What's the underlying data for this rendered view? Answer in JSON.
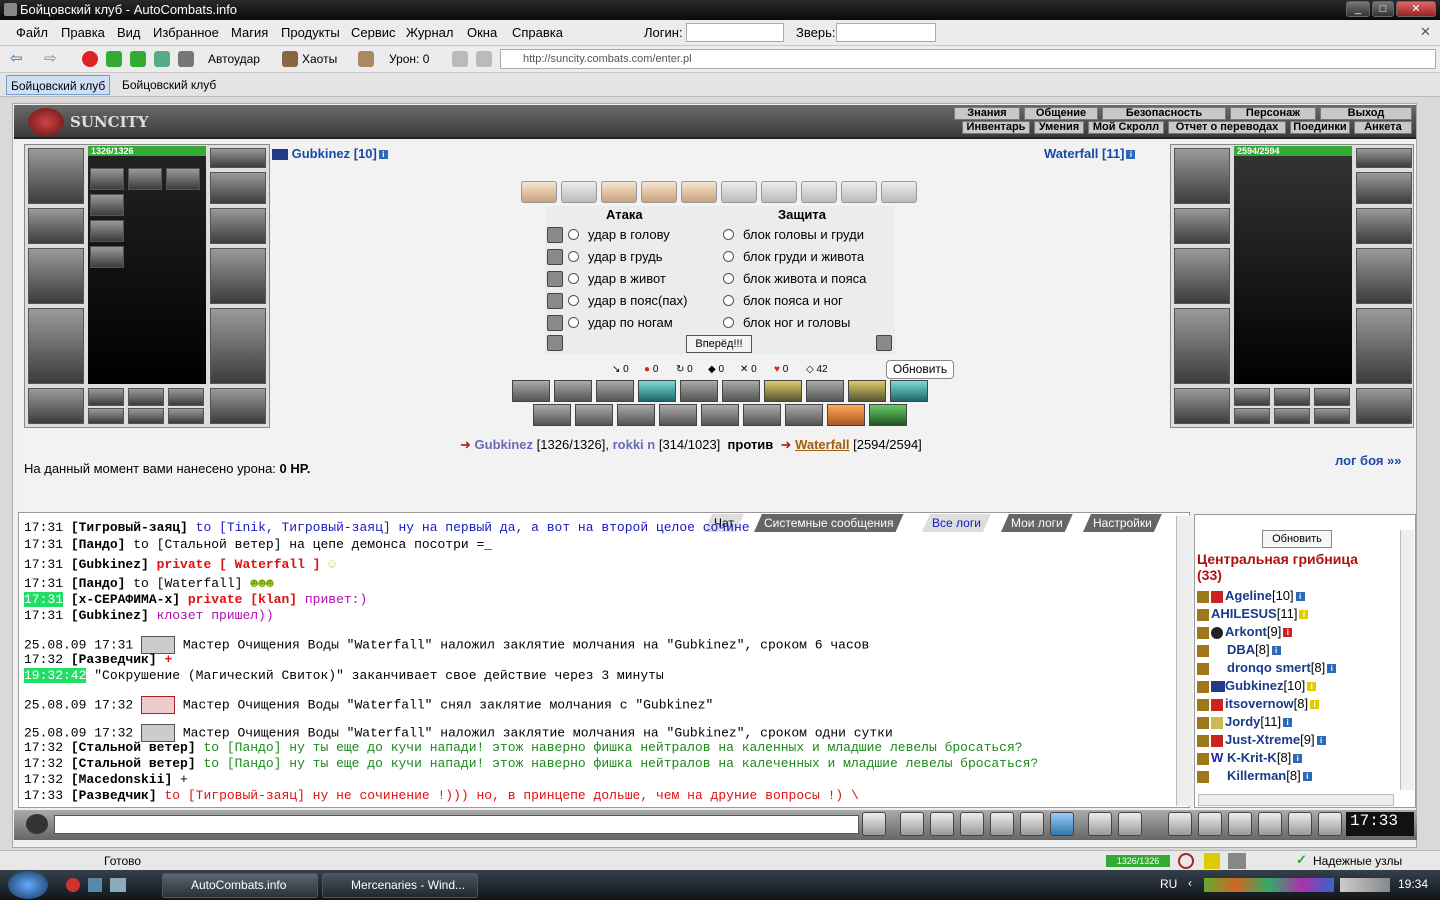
{
  "window": {
    "title": "Бойцовский клуб - AutoCombats.info"
  },
  "menu": {
    "items": [
      "Файл",
      "Правка",
      "Вид",
      "Избранное",
      "Магия",
      "Продукты",
      "Сервис",
      "Журнал",
      "Окна",
      "Справка"
    ],
    "login_label": "Логин:",
    "beast_label": "Зверь:"
  },
  "toolbar": {
    "autoudar": "Автоудар",
    "chaos": "Хаоты",
    "damage": "Урон: 0",
    "url": "http://suncity.combats.com/enter.pl"
  },
  "tabs": [
    "Бойцовский клуб",
    "Бойцовский клуб"
  ],
  "game_nav": {
    "top": [
      "Знания",
      "Общение",
      "Безопасность",
      "Персонаж",
      "Выход"
    ],
    "bottom": [
      "Инвентарь",
      "Умения",
      "Мой Скролл",
      "Отчет о переводах",
      "Поединки",
      "Анкета"
    ],
    "logo": "SUNCITY"
  },
  "player": {
    "name": "Gubkinez [10]",
    "hp": "1326/1326"
  },
  "enemy": {
    "name": "Waterfall [11]",
    "hp": "2594/2594"
  },
  "combat": {
    "attack_header": "Атака",
    "defense_header": "Защита",
    "attacks": [
      "удар в голову",
      "удар в грудь",
      "удар в живот",
      "удар в пояс(пах)",
      "удар по ногам"
    ],
    "blocks": [
      "блок головы и груди",
      "блок груди и живота",
      "блок живота и пояса",
      "блок пояса и ног",
      "блок ног и головы"
    ],
    "forward_button": "Вперёд!!!",
    "refresh_button": "Обновить",
    "stats": [
      "0",
      "0",
      "0",
      "0",
      "0",
      "0",
      "42"
    ]
  },
  "vs": {
    "p1": "Gubkinez",
    "p1hp": "[1326/1326],",
    "p2": "rokki n",
    "p2hp": "[314/1023]",
    "versus": "против",
    "p3": "Waterfall",
    "p3hp": "[2594/2594]"
  },
  "damage_text": {
    "prefix": "На данный момент вами нанесено урона: ",
    "value": "0 HP."
  },
  "log_link": "лог боя »»",
  "chat_tabs": [
    "Чат",
    "Системные сообщения",
    "Все логи",
    "Мои логи",
    "Настройки"
  ],
  "chat": [
    {
      "time": "17:31",
      "nick": "[Тигровый-заяц]",
      "text": " to [Tinik, Тигровый-заяц] ну на первый да, а вот на второй целое сочине"
    },
    {
      "time": "17:31",
      "nick": "[Пандо]",
      "text": " to [Стальной ветер] на цепе демонса посотри =_"
    },
    {
      "time": "17:31",
      "nick": "[Gubkinez]",
      "private": "private [ Waterfall ]",
      "text": ""
    },
    {
      "time": "17:31",
      "nick": "[Пандо]",
      "text": " to [Waterfall]"
    },
    {
      "time": "17:31",
      "nick": "[x-СЕРАФИМА-x]",
      "private": "private [klan]",
      "text": " привет:)"
    },
    {
      "time": "17:31",
      "nick": "[Gubkinez]",
      "text": " клозет пришел))"
    },
    {
      "time": "25.08.09 17:31",
      "text": "Мастер Очищения Воды \"Waterfall\" наложил заклятие молчания на \"Gubkinez\", сроком 6 часов"
    },
    {
      "time": "17:32",
      "nick": "[Разведчик]",
      "text": " +"
    },
    {
      "time": "19:32:42",
      "text": "\"Сокрушение (Магический Свиток)\" заканчивает свое действие через 3 минуты"
    },
    {
      "time": "25.08.09 17:32",
      "text": "Мастер Очищения Воды \"Waterfall\" снял заклятие молчания с \"Gubkinez\""
    },
    {
      "time": "25.08.09 17:32",
      "text": "Мастер Очищения Воды \"Waterfall\" наложил заклятие молчания на \"Gubkinez\", сроком одни сутки"
    },
    {
      "time": "17:32",
      "nick": "[Стальной ветер]",
      "text": " to [Пандо] ну ты еще до кучи напади! этож наверно фишка нейтралов на каленных и младшие левелы бросаться?"
    },
    {
      "time": "17:32",
      "nick": "[Стальной ветер]",
      "text": " to [Пандо] ну ты еще до кучи напади! этож наверно фишка нейтралов на калеченных и младшие левелы бросаться?"
    },
    {
      "time": "17:32",
      "nick": "[Macedonskii]",
      "text": " +"
    },
    {
      "time": "17:33",
      "nick": "[Разведчик]",
      "text": " to [Тигровый-заяц] ну не сочинение !))) но, в принцепе дольше, чем на друние вопросы !) \\"
    }
  ],
  "side": {
    "refresh": "Обновить",
    "room": "Центральная грибница",
    "count": "(33)",
    "users": [
      {
        "name": "Ageline",
        "lv": "[10]"
      },
      {
        "name": "AHILESUS",
        "lv": "[11]"
      },
      {
        "name": "Arkont",
        "lv": "[9]"
      },
      {
        "name": "DBA",
        "lv": "[8]"
      },
      {
        "name": "dronqo smert",
        "lv": "[8]"
      },
      {
        "name": "Gubkinez",
        "lv": "[10]"
      },
      {
        "name": "itsovernow",
        "lv": "[8]"
      },
      {
        "name": "Jordy",
        "lv": "[11]"
      },
      {
        "name": "Just-Xtreme",
        "lv": "[9]"
      },
      {
        "name": "K-Krit-K",
        "lv": "[8]"
      },
      {
        "name": "Killerman",
        "lv": "[8]"
      }
    ]
  },
  "clock": "17:33",
  "status": {
    "ready": "Готово",
    "hp": "1326/1326",
    "secure": "Надежные узлы"
  },
  "taskbar": {
    "tasks": [
      "AutoCombats.info",
      "Mercenaries - Wind..."
    ],
    "lang": "RU",
    "time": "19:34"
  }
}
